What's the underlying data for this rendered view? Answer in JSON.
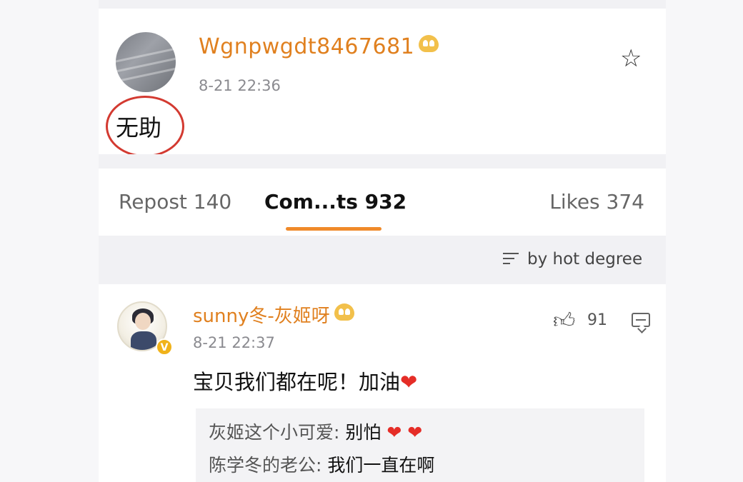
{
  "post": {
    "username": "Wgnpwgdt8467681",
    "timestamp": "8-21 22:36",
    "text": "无助",
    "icons": {
      "favorite": "star-outline-icon",
      "member": "vip-badge-icon"
    }
  },
  "tabs": {
    "repost": "Repost 140",
    "comments": "Com...ts 932",
    "likes": "Likes 374",
    "active": "comments",
    "accent_color": "#f08a2a"
  },
  "sort": {
    "label": "by hot degree",
    "icon": "sort-lines-icon"
  },
  "comment": {
    "username": "sunny冬-灰姬呀",
    "timestamp": "8-21 22:37",
    "text": "宝贝我们都在呢！加油",
    "heart": "❤",
    "like_count": "91",
    "icons": {
      "like": "thumbs-up-icon",
      "reply": "comment-icon",
      "verified": "verified-v-icon"
    },
    "verified_label": "V",
    "replies": [
      {
        "name": "灰姬这个小可爱:",
        "text": "别怕",
        "hearts": "❤ ❤"
      },
      {
        "name": "陈学冬的老公:",
        "text": "我们一直在啊",
        "hearts": ""
      }
    ]
  },
  "colors": {
    "username": "#e0801f",
    "highlight_circle": "#d33a31",
    "heart": "#e52d27"
  }
}
